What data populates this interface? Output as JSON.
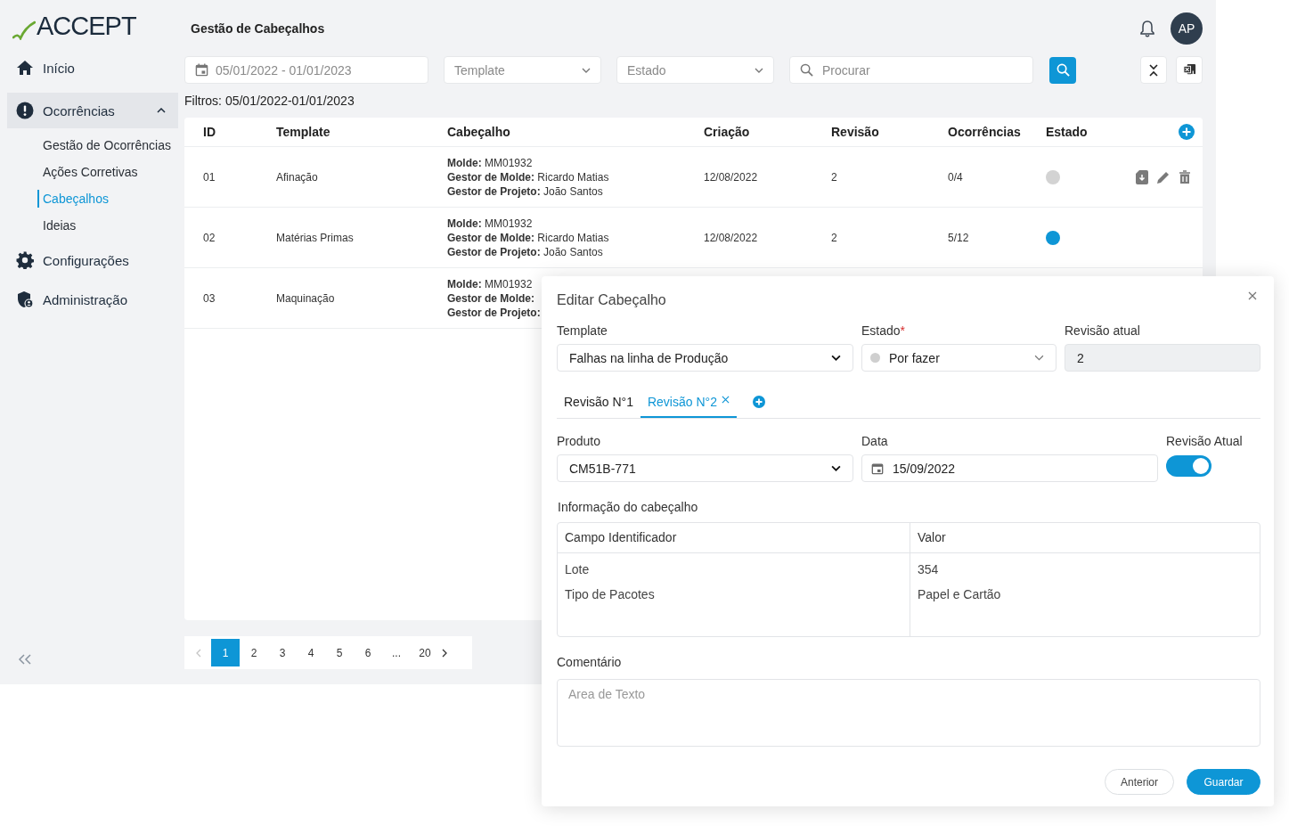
{
  "logo": {
    "text": "ACCEPT"
  },
  "sidebar": {
    "items": [
      {
        "label": "Início",
        "selected": false
      },
      {
        "label": "Ocorrências",
        "selected": true,
        "expanded": true,
        "children": [
          {
            "label": "Gestão de Ocorrências",
            "selected": false
          },
          {
            "label": "Ações Corretivas",
            "selected": false
          },
          {
            "label": "Cabeçalhos",
            "selected": true
          },
          {
            "label": "Ideias",
            "selected": false
          }
        ]
      },
      {
        "label": "Configurações",
        "selected": false
      },
      {
        "label": "Administração",
        "selected": false
      }
    ]
  },
  "page_title": "Gestão de Cabeçalhos",
  "user": {
    "initials": "AP"
  },
  "filters": {
    "date_range": "05/01/2022 - 01/01/2023",
    "template": {
      "placeholder": "Template"
    },
    "estado": {
      "placeholder": "Estado"
    },
    "search": {
      "placeholder": "Procurar"
    }
  },
  "filters_summary": {
    "label": "Filtros:",
    "value": "05/01/2022-01/01/2023"
  },
  "table": {
    "columns": [
      "ID",
      "Template",
      "Cabeçalho",
      "Criação",
      "Revisão",
      "Ocorrências",
      "Estado"
    ],
    "rows": [
      {
        "id": "01",
        "template": "Afinação",
        "header": [
          "**Molde:** MM01932",
          "**Gestor de Molde:** Ricardo Matias",
          "**Gestor de Projeto:** João Santos"
        ],
        "created": "12/08/2022",
        "revision": "2",
        "occurrences": "0/4",
        "color": "#d3d3d3",
        "hovered": true
      },
      {
        "id": "02",
        "template": "Matérias Primas",
        "header": [
          "**Molde:** MM01932",
          "**Gestor de Molde:** Ricardo Matias",
          "**Gestor de Projeto:** João Santos"
        ],
        "created": "12/08/2022",
        "revision": "2",
        "occurrences": "5/12",
        "color": "#0e96d6",
        "hovered": false
      },
      {
        "id": "03",
        "template": "Maquinação",
        "header": [
          "**Molde:** MM01932",
          "**Gestor de Molde:**",
          "**Gestor de Projeto:**"
        ]
      }
    ]
  },
  "pagination": {
    "prev_disabled": true,
    "pages": [
      {
        "label": "1",
        "selected": true
      },
      {
        "label": "2",
        "selected": false
      },
      {
        "label": "3",
        "selected": false
      },
      {
        "label": "4",
        "selected": false
      },
      {
        "label": "5",
        "selected": false
      },
      {
        "label": "6",
        "selected": false
      },
      {
        "label": "...",
        "selected": false
      },
      {
        "label": "20",
        "selected": false
      }
    ]
  },
  "modal": {
    "title": "Editar Cabeçalho",
    "template": {
      "label": "Template",
      "value": "Falhas na linha de Produção"
    },
    "estado": {
      "label": "Estado",
      "required_mark": "*",
      "value": "Por fazer",
      "color": "#cfcfcf"
    },
    "revisao_atual": {
      "label": "Revisão atual",
      "value": "2",
      "disabled": true
    },
    "tabs": [
      {
        "label": "Revisão N°1",
        "selected": false,
        "closable": false
      },
      {
        "label": "Revisão N°2",
        "selected": true,
        "closable": true
      }
    ],
    "produto": {
      "label": "Produto",
      "value": "CM51B-771"
    },
    "data": {
      "label": "Data",
      "value": "15/09/2022"
    },
    "toggle": {
      "label": "Revisão Atual",
      "on": true
    },
    "info": {
      "title": "Informação do cabeçalho",
      "columns": [
        "Campo Identificador",
        "Valor"
      ],
      "rows": [
        [
          "Lote",
          "354"
        ],
        [
          "Tipo de Pacotes",
          "Papel e Cartão"
        ]
      ]
    },
    "comment": {
      "label": "Comentário",
      "placeholder": "Area de Texto"
    },
    "buttons": [
      {
        "label": "Anterior",
        "kind": "secondary"
      },
      {
        "label": "Guardar",
        "kind": "primary"
      }
    ]
  }
}
